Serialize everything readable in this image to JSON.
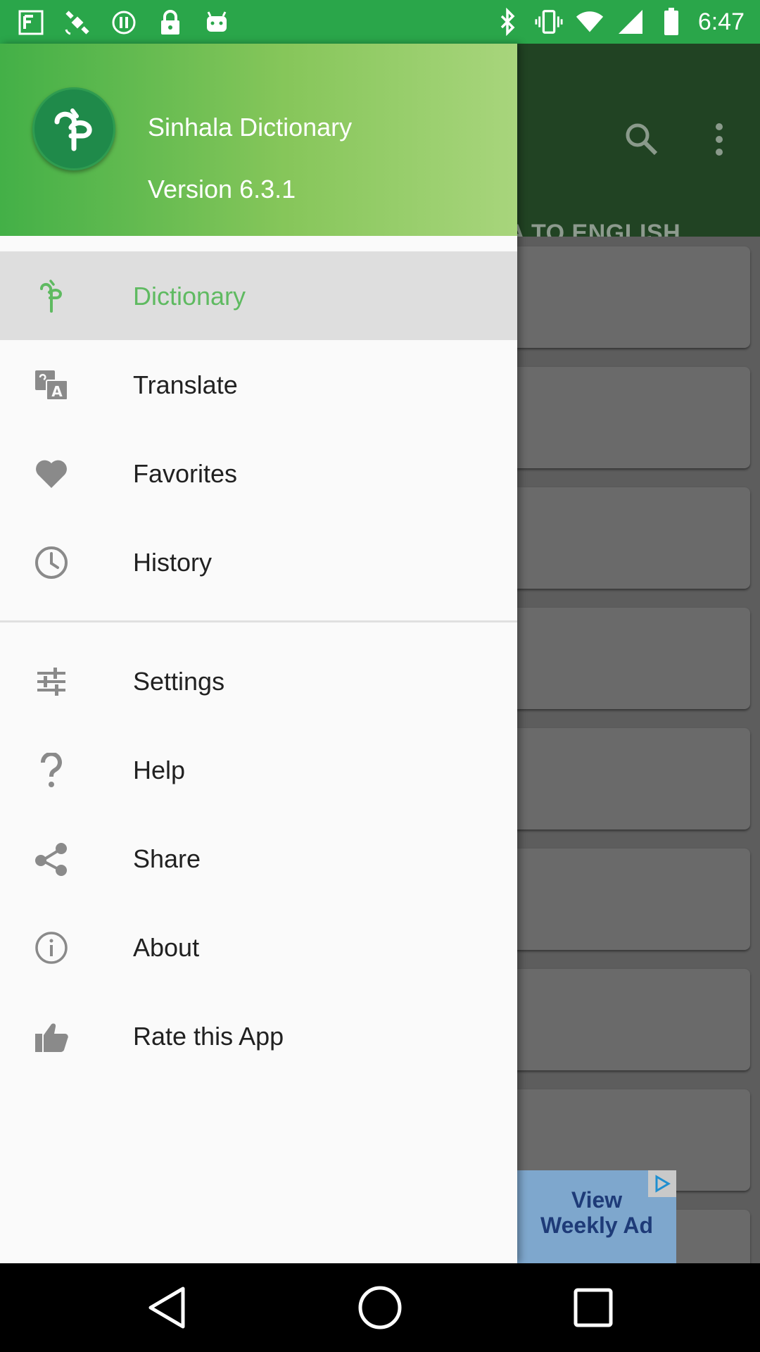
{
  "status_bar": {
    "time": "6:47",
    "left_icons": [
      "fake-gps-icon",
      "satellite-icon",
      "pause-circle-icon",
      "lock-icon",
      "android-icon"
    ],
    "right_icons": [
      "bluetooth-icon",
      "vibrate-icon",
      "wifi-icon",
      "signal-icon",
      "battery-icon"
    ]
  },
  "drawer": {
    "header": {
      "app_name": "Sinhala Dictionary",
      "version": "Version 6.3.1"
    },
    "items": [
      {
        "label": "Dictionary",
        "icon": "sinhala-letter-icon",
        "selected": true
      },
      {
        "label": "Translate",
        "icon": "translate-icon"
      },
      {
        "label": "Favorites",
        "icon": "heart-icon"
      },
      {
        "label": "History",
        "icon": "clock-icon"
      },
      {
        "label": "Settings",
        "icon": "sliders-icon"
      },
      {
        "label": "Help",
        "icon": "question-icon"
      },
      {
        "label": "Share",
        "icon": "share-icon"
      },
      {
        "label": "About",
        "icon": "info-icon"
      },
      {
        "label": "Rate this App",
        "icon": "thumbs-up-icon"
      }
    ]
  },
  "background": {
    "tab_partial": "LA TO ENGLISH",
    "ad": {
      "line1": "View",
      "line2": "Weekly Ad"
    }
  },
  "colors": {
    "status_bar": "#2aa64a",
    "accent": "#5fba61",
    "header_start": "#43b047",
    "header_end": "#a8d57c"
  }
}
